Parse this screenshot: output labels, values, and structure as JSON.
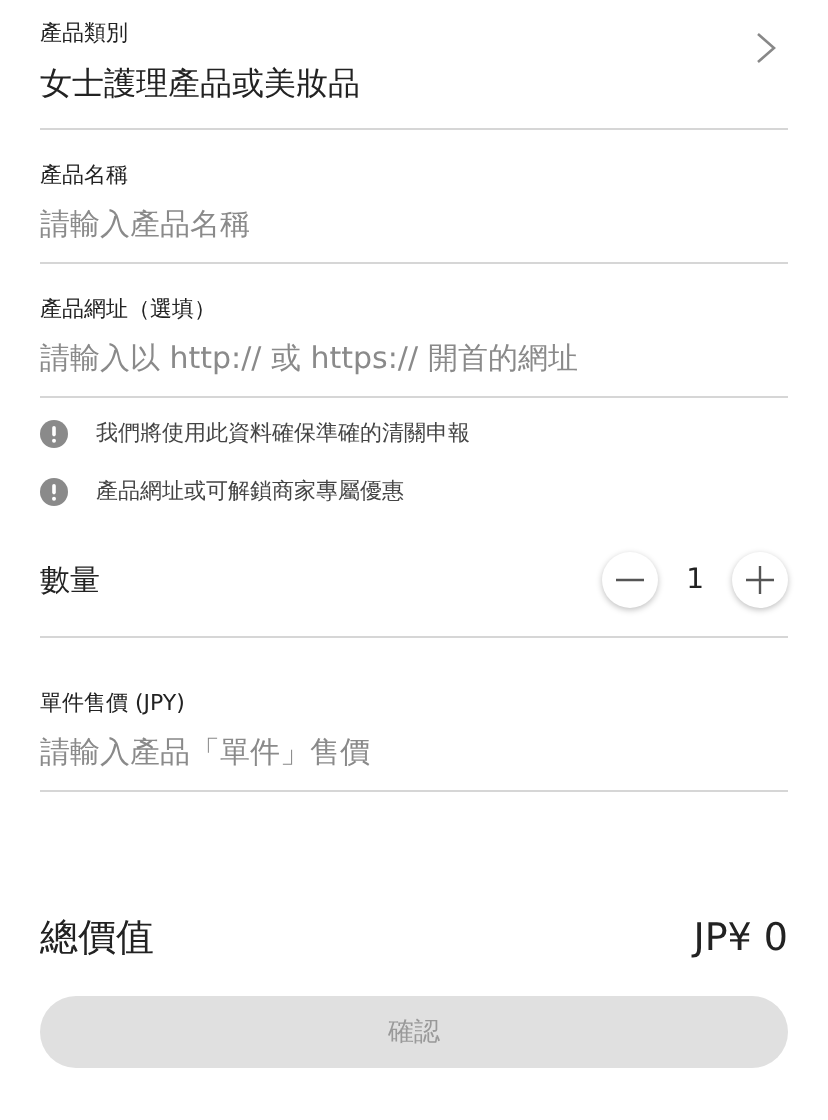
{
  "category": {
    "label": "產品類別",
    "value": "女士護理產品或美妝品"
  },
  "product_name": {
    "label": "產品名稱",
    "placeholder": "請輸入產品名稱"
  },
  "product_url": {
    "label": "產品網址（選填）",
    "placeholder": "請輸入以 http:// 或 https:// 開首的網址"
  },
  "notes": [
    "我們將使用此資料確保準確的清關申報",
    "產品網址或可解鎖商家專屬優惠"
  ],
  "quantity": {
    "label": "數量",
    "value": "1"
  },
  "unit_price": {
    "label": "單件售價 (JPY)",
    "placeholder": "請輸入產品「單件」售價"
  },
  "total": {
    "label": "總價值",
    "value": "JP¥ 0"
  },
  "confirm_button": {
    "label": "確認",
    "disabled": true
  }
}
